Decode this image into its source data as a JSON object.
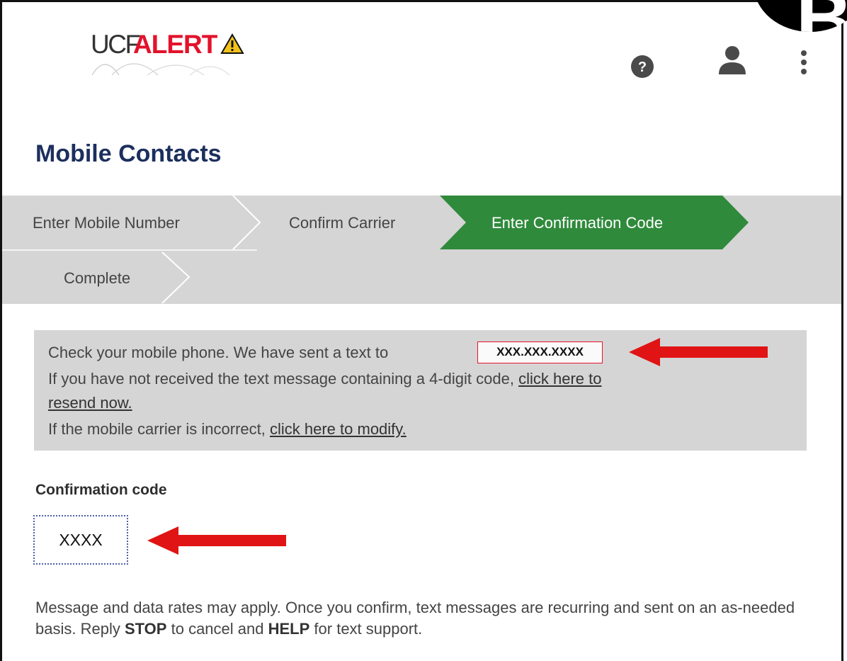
{
  "header": {
    "logo": {
      "part1": "UCF",
      "part2": "ALERT"
    },
    "icons": [
      "help-icon",
      "user-icon",
      "more-vertical-icon"
    ]
  },
  "page_title": "Mobile Contacts",
  "stepper": {
    "steps": [
      {
        "label": "Enter Mobile Number"
      },
      {
        "label": "Confirm Carrier"
      },
      {
        "label": "Enter Confirmation Code"
      },
      {
        "label": "Complete"
      }
    ],
    "active_index": 2
  },
  "info": {
    "line1": "Check your mobile phone. We have sent a text to",
    "phone": "XXX.XXX.XXXX",
    "line2_prefix": "If you have not received the text message containing a 4-digit code,",
    "resend_link": "click here to",
    "resend_link_cont": "resend now.",
    "line3_prefix": "If the mobile carrier is incorrect,",
    "modify_link": "click here to modify."
  },
  "confirmation": {
    "label": "Confirmation code",
    "value": "XXXX"
  },
  "disclaimer": {
    "part1": "Message and data rates may apply. Once you confirm, text messages are recurring and sent on an as-needed basis. Reply",
    "stop": "STOP",
    "part2": "to cancel and",
    "help": "HELP",
    "part3": "for text support."
  },
  "colors": {
    "title": "#1c2f5e",
    "active_step": "#2f8a3b",
    "step_bg": "#d5d5d5",
    "alert_red": "#e3122b",
    "arrow_red": "#e01414"
  }
}
